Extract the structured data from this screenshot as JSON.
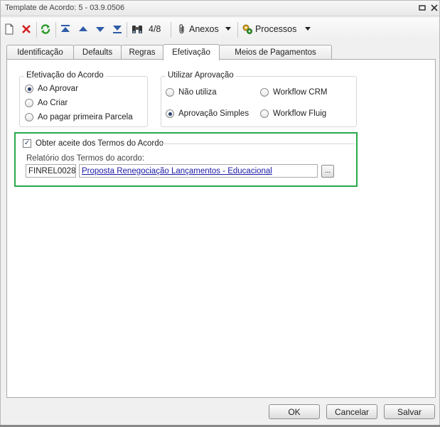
{
  "window": {
    "title": "Template de Acordo: 5 - 03.9.0506"
  },
  "toolbar": {
    "record_position": "4/8",
    "anexos_label": "Anexos",
    "processos_label": "Processos"
  },
  "tabs": [
    {
      "label": "Identificação"
    },
    {
      "label": "Defaults"
    },
    {
      "label": "Regras"
    },
    {
      "label": "Efetivação"
    },
    {
      "label": "Meios de Pagamentos"
    }
  ],
  "active_tab": "Efetivação",
  "efetivacao_group": {
    "title": "Efetivação do Acordo",
    "options": [
      {
        "label": "Ao Aprovar",
        "checked": true
      },
      {
        "label": "Ao Criar",
        "checked": false
      },
      {
        "label": "Ao pagar primeira Parcela",
        "checked": false
      }
    ]
  },
  "aprovacao_group": {
    "title": "Utilizar Aprovação",
    "options": [
      {
        "label": "Não utiliza",
        "checked": false
      },
      {
        "label": "Workflow CRM",
        "checked": false
      },
      {
        "label": "Aprovação Simples",
        "checked": true
      },
      {
        "label": "Workflow Fluig",
        "checked": false
      }
    ]
  },
  "termos": {
    "checkbox_label": "Obter aceite dos Termos do Acordo",
    "checked": true,
    "report_label": "Relatório dos Termos do acordo:",
    "report_code": "FINREL0028",
    "report_name": "Proposta Renegociação Lançamentos - Educacional",
    "browse_label": "..."
  },
  "buttons": {
    "ok": "OK",
    "cancel": "Cancelar",
    "save": "Salvar"
  },
  "colors": {
    "highlight_frame": "#2aa84a",
    "link": "#1a1aa6"
  }
}
